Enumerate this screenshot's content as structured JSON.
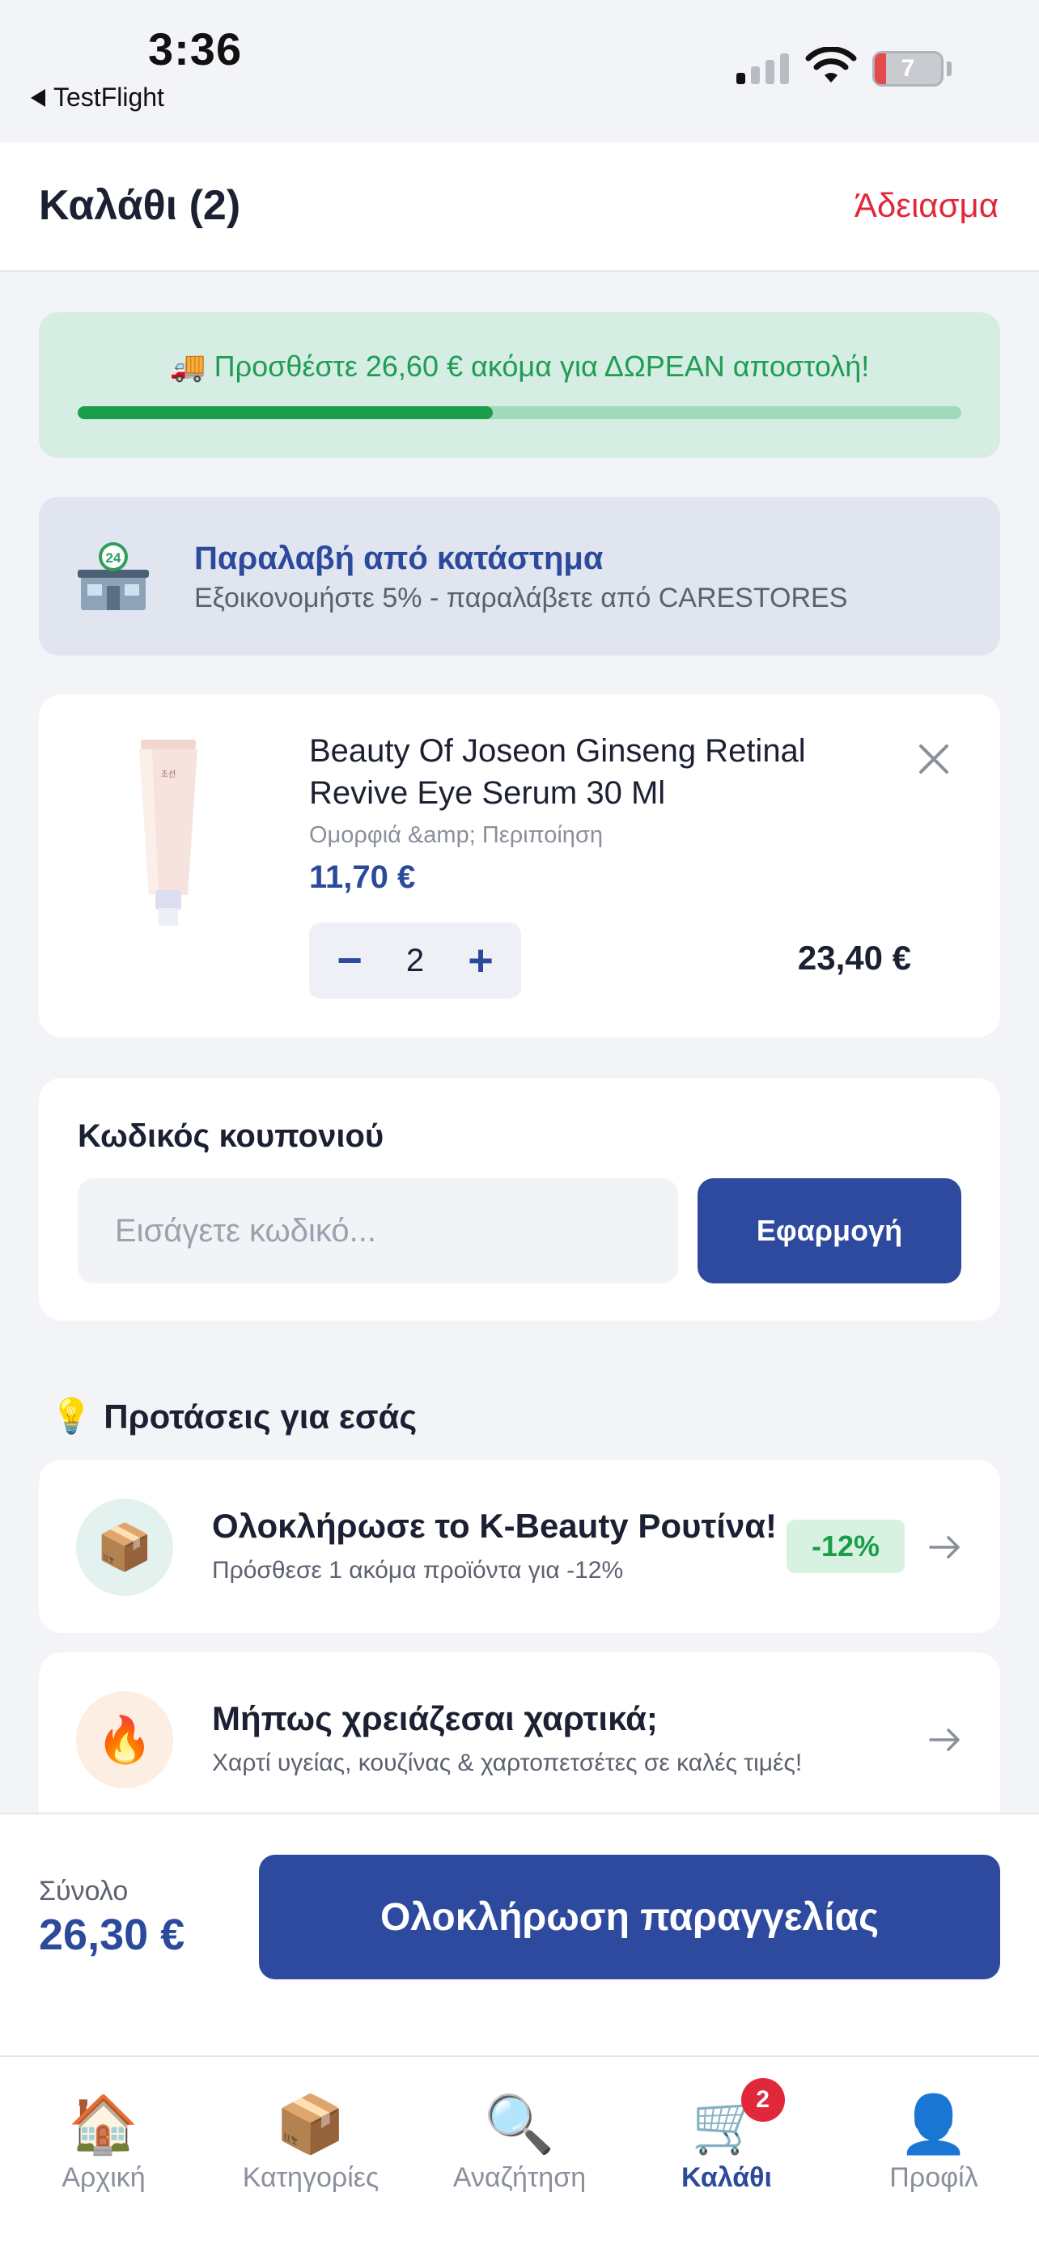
{
  "status_bar": {
    "time": "3:36",
    "back_app": "TestFlight",
    "battery": "7"
  },
  "header": {
    "title": "Καλάθι (2)",
    "clear_label": "Άδειασμα"
  },
  "shipping": {
    "icon": "🚚",
    "message": "Προσθέστε 26,60 € ακόμα για ΔΩΡΕΑΝ αποστολή!",
    "progress": 0.47,
    "accent": "#1a9e4a"
  },
  "pickup": {
    "icon": "store-24h-icon",
    "title": "Παραλαβή από κατάστημα",
    "subtitle": "Εξοικονομήστε 5% - παραλάβετε από CARESTORES"
  },
  "cart": {
    "items": [
      {
        "name": "Beauty Of Joseon Ginseng Retinal Revive Eye Serum 30 Ml",
        "category": "Ομορφιά &amp; Περιποίηση",
        "unit_price": "11,70 €",
        "quantity": "2",
        "line_total": "23,40 €",
        "decrement": "−",
        "increment": "+"
      }
    ]
  },
  "coupon": {
    "label": "Κωδικός κουπονιού",
    "placeholder": "Εισάγετε κωδικό...",
    "apply_label": "Εφαρμογή"
  },
  "suggestions": {
    "title": "Προτάσεις για εσάς",
    "title_icon": "💡",
    "items": [
      {
        "icon": "📦",
        "title": "Ολοκλήρωσε το K-Beauty Ρουτίνα!",
        "subtitle": "Πρόσθεσε 1 ακόμα προϊόντα για -12%",
        "badge": "-12%"
      },
      {
        "icon": "🔥",
        "title": "Μήπως χρειάζεσαι χαρτικά;",
        "subtitle": "Χαρτί υγείας, κουζίνας & χαρτοπετσέτες σε καλές τιμές!"
      }
    ]
  },
  "checkout": {
    "total_label": "Σύνολο",
    "total_value": "26,30 €",
    "button_label": "Ολοκλήρωση παραγγελίας"
  },
  "tabbar": {
    "tabs": [
      {
        "icon": "🏠",
        "label": "Αρχική"
      },
      {
        "icon": "📦",
        "label": "Κατηγορίες"
      },
      {
        "icon": "🔍",
        "label": "Αναζήτηση"
      },
      {
        "icon": "🛒",
        "label": "Καλάθι",
        "badge": "2"
      },
      {
        "icon": "👤",
        "label": "Προφίλ"
      }
    ]
  },
  "colors": {
    "brand": "#2e4a9e",
    "danger": "#e0283a",
    "success": "#1a9e4a"
  }
}
